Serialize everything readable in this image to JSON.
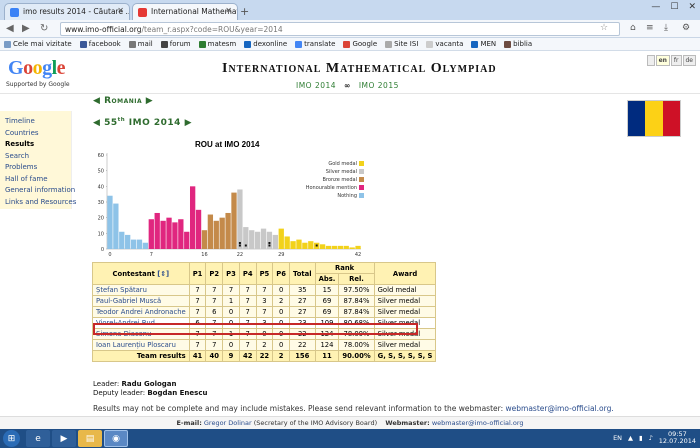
{
  "browser": {
    "tabs": [
      {
        "title": "imo results 2014 - Căutare ...",
        "active": false
      },
      {
        "title": "International Mathematical ...",
        "active": true
      }
    ],
    "url_host": "www.imo-official.org",
    "url_path": "/team_r.aspx?code=ROU&year=2014",
    "bookmarks": [
      "Cele mai vizitate",
      "facebook",
      "mail",
      "forum",
      "matesm",
      "dexonline",
      "translate",
      "Google",
      "Site ISI",
      "vacanta",
      "MEN",
      "biblia"
    ]
  },
  "header": {
    "logo": "Google",
    "supported": "Supported by Google",
    "title": "International Mathematical Olympiad",
    "link1": "IMO 2014",
    "link2": "IMO 2015",
    "langs": [
      "",
      "en",
      "fr",
      "de"
    ]
  },
  "sidebar": {
    "items": [
      "Timeline",
      "Countries",
      "Results",
      "Search",
      "Problems",
      "Hall of fame",
      "General information",
      "Links and Resources"
    ]
  },
  "heading": {
    "country": "Romania",
    "imo_num": "55",
    "imo_sup": "th",
    "imo_text": "IMO 2014"
  },
  "chart_data": {
    "type": "bar",
    "title": "ROU at IMO 2014",
    "ylim": [
      0,
      60
    ],
    "yticks": [
      0,
      10,
      20,
      30,
      40,
      50,
      60
    ],
    "xticks": [
      "0",
      "7",
      "16",
      "22",
      "29",
      "42"
    ],
    "legend": [
      {
        "name": "Gold medal",
        "color": "#f2d21b"
      },
      {
        "name": "Silver medal",
        "color": "#c8c8c8"
      },
      {
        "name": "Bronze medal",
        "color": "#c48a4a"
      },
      {
        "name": "Honourable mention",
        "color": "#e0267f"
      },
      {
        "name": "Nothing",
        "color": "#8ec3e8"
      }
    ],
    "bars": [
      {
        "x": 0,
        "v": 34,
        "c": "nothing"
      },
      {
        "x": 1,
        "v": 29,
        "c": "nothing"
      },
      {
        "x": 2,
        "v": 11,
        "c": "nothing"
      },
      {
        "x": 3,
        "v": 9,
        "c": "nothing"
      },
      {
        "x": 4,
        "v": 6,
        "c": "nothing"
      },
      {
        "x": 5,
        "v": 6,
        "c": "nothing"
      },
      {
        "x": 6,
        "v": 4,
        "c": "nothing"
      },
      {
        "x": 7,
        "v": 19,
        "c": "hm"
      },
      {
        "x": 8,
        "v": 23,
        "c": "hm"
      },
      {
        "x": 9,
        "v": 18,
        "c": "hm"
      },
      {
        "x": 10,
        "v": 20,
        "c": "hm"
      },
      {
        "x": 11,
        "v": 17,
        "c": "hm"
      },
      {
        "x": 12,
        "v": 19,
        "c": "hm"
      },
      {
        "x": 13,
        "v": 11,
        "c": "hm"
      },
      {
        "x": 14,
        "v": 40,
        "c": "hm"
      },
      {
        "x": 15,
        "v": 25,
        "c": "hm"
      },
      {
        "x": 16,
        "v": 12,
        "c": "bronze"
      },
      {
        "x": 17,
        "v": 22,
        "c": "bronze"
      },
      {
        "x": 18,
        "v": 18,
        "c": "bronze"
      },
      {
        "x": 19,
        "v": 20,
        "c": "bronze"
      },
      {
        "x": 20,
        "v": 23,
        "c": "bronze"
      },
      {
        "x": 21,
        "v": 36,
        "c": "bronze"
      },
      {
        "x": 22,
        "v": 38,
        "c": "silver"
      },
      {
        "x": 23,
        "v": 14,
        "c": "silver"
      },
      {
        "x": 24,
        "v": 12,
        "c": "silver"
      },
      {
        "x": 25,
        "v": 11,
        "c": "silver"
      },
      {
        "x": 26,
        "v": 13,
        "c": "silver"
      },
      {
        "x": 27,
        "v": 11,
        "c": "silver"
      },
      {
        "x": 28,
        "v": 9,
        "c": "silver"
      },
      {
        "x": 29,
        "v": 13,
        "c": "gold"
      },
      {
        "x": 30,
        "v": 8,
        "c": "gold"
      },
      {
        "x": 31,
        "v": 5,
        "c": "gold"
      },
      {
        "x": 32,
        "v": 6,
        "c": "gold"
      },
      {
        "x": 33,
        "v": 4,
        "c": "gold"
      },
      {
        "x": 34,
        "v": 5,
        "c": "gold"
      },
      {
        "x": 35,
        "v": 4,
        "c": "gold"
      },
      {
        "x": 36,
        "v": 3,
        "c": "gold"
      },
      {
        "x": 37,
        "v": 2,
        "c": "gold"
      },
      {
        "x": 38,
        "v": 2,
        "c": "gold"
      },
      {
        "x": 39,
        "v": 2,
        "c": "gold"
      },
      {
        "x": 40,
        "v": 2,
        "c": "gold"
      },
      {
        "x": 41,
        "v": 1,
        "c": "gold"
      },
      {
        "x": 42,
        "v": 2,
        "c": "gold"
      }
    ],
    "team_markers": [
      23,
      27,
      27,
      22,
      22,
      35
    ]
  },
  "table": {
    "headers": {
      "contestant": "Contestant",
      "sort": "[⇕]",
      "p1": "P1",
      "p2": "P2",
      "p3": "P3",
      "p4": "P4",
      "p5": "P5",
      "p6": "P6",
      "total": "Total",
      "rank": "Rank",
      "abs": "Abs.",
      "rel": "Rel.",
      "award": "Award"
    },
    "rows": [
      {
        "name": "Ștefan Spătaru",
        "p": [
          "7",
          "7",
          "7",
          "7",
          "7",
          "0"
        ],
        "total": "35",
        "abs": "15",
        "rel": "97.50%",
        "award": "Gold medal"
      },
      {
        "name": "Paul-Gabriel Muscă",
        "p": [
          "7",
          "7",
          "1",
          "7",
          "3",
          "2"
        ],
        "total": "27",
        "abs": "69",
        "rel": "87.84%",
        "award": "Silver medal"
      },
      {
        "name": "Teodor Andrei Andronache",
        "p": [
          "7",
          "6",
          "0",
          "7",
          "7",
          "0"
        ],
        "total": "27",
        "abs": "69",
        "rel": "87.84%",
        "award": "Silver medal"
      },
      {
        "name": "Viorel-Andrei Bud",
        "p": [
          "6",
          "7",
          "0",
          "7",
          "3",
          "0"
        ],
        "total": "23",
        "abs": "109",
        "rel": "80.68%",
        "award": "Silver medal"
      },
      {
        "name": "Simona Diaconu",
        "p": [
          "7",
          "7",
          "1",
          "7",
          "0",
          "0"
        ],
        "total": "22",
        "abs": "124",
        "rel": "78.00%",
        "award": "Silver medal"
      },
      {
        "name": "Ioan Laurențiu Ploscaru",
        "p": [
          "7",
          "7",
          "0",
          "7",
          "2",
          "0"
        ],
        "total": "22",
        "abs": "124",
        "rel": "78.00%",
        "award": "Silver medal"
      }
    ],
    "team": {
      "label": "Team results",
      "p": [
        "41",
        "40",
        "9",
        "42",
        "22",
        "2"
      ],
      "total": "156",
      "abs": "11",
      "rel": "90.00%",
      "award": "G, S, S, S, S, S"
    }
  },
  "leaders": {
    "leader_label": "Leader:",
    "leader": "Radu Gologan",
    "deputy_label": "Deputy leader:",
    "deputy": "Bogdan Enescu"
  },
  "disclaimer": {
    "text": "Results may not be complete and may include mistakes. Please send relevant information to the webmaster:",
    "email": "webmaster@imo-official.org."
  },
  "footer": {
    "email_label": "E-mail:",
    "email_name": "Gregor Dolinar",
    "email_note": "(Secretary of the IMO Advisory Board)",
    "webmaster_label": "Webmaster:",
    "webmaster": "webmaster@imo-official.org"
  },
  "taskbar": {
    "lang": "EN",
    "time": "09:57",
    "date": "12.07.2014"
  },
  "colors": {
    "accent_green": "#2e6b2e",
    "link": "#2a4c8c",
    "highlight": "#c62828",
    "flag": [
      "#002b7f",
      "#fcd116",
      "#ce1126"
    ]
  }
}
